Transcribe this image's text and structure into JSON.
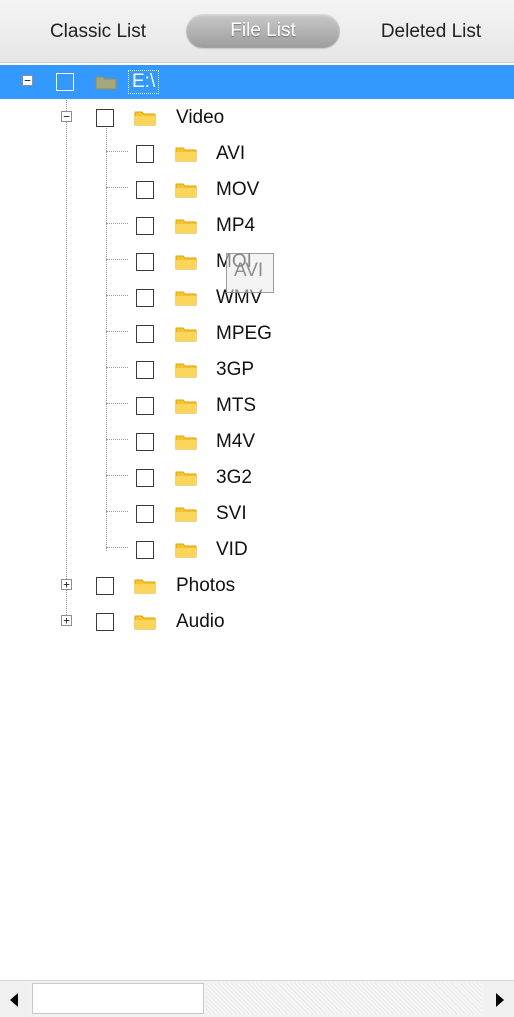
{
  "tabs": {
    "classic": "Classic List",
    "file": "File List",
    "deleted": "Deleted List"
  },
  "tree": {
    "root": {
      "label": "E:\\",
      "expander": "−"
    },
    "video": {
      "label": "Video",
      "expander": "−"
    },
    "video_children": [
      "AVI",
      "MOV",
      "MP4",
      "MOI",
      "WMV",
      "MPEG",
      "3GP",
      "MTS",
      "M4V",
      "3G2",
      "SVI",
      "VID"
    ],
    "photos": {
      "label": "Photos",
      "expander": "+"
    },
    "audio": {
      "label": "Audio",
      "expander": "+"
    }
  },
  "drag_ghost": {
    "label": "AVI"
  },
  "colors": {
    "selection": "#3399ff",
    "folder": "#f7c22b",
    "folder_root": "#a4a87a"
  },
  "icons": {
    "folder": "folder-icon",
    "drive": "drive-folder-icon",
    "expand": "expand-icon",
    "collapse": "collapse-icon"
  }
}
